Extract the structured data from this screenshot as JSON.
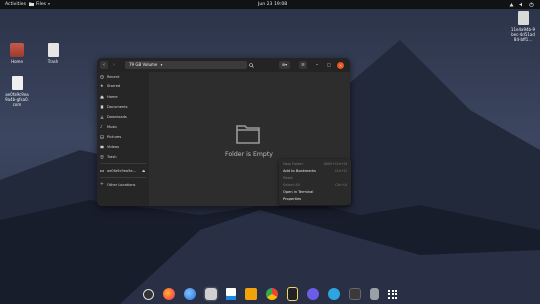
{
  "topbar": {
    "activities": "Activities",
    "app_name": "Files",
    "clock": "Jun 23  19:08"
  },
  "desktop": {
    "icons": [
      {
        "label": "Home",
        "icon": "home-folder-icon"
      },
      {
        "label": "Trash",
        "icon": "trash-icon"
      },
      {
        "label": "ae0fa9c9ea9a4b-gfsa0.com",
        "icon": "text-file-icon"
      },
      {
        "label": "11e4a94b-9bec-4d51ad84-bff1...",
        "icon": "drive-icon"
      }
    ]
  },
  "window": {
    "path_label": "79 GB Volume",
    "empty_text": "Folder is Empty",
    "sidebar": [
      {
        "label": "Recent",
        "icon": "clock-icon"
      },
      {
        "label": "Starred",
        "icon": "star-icon"
      },
      {
        "label": "Home",
        "icon": "home-icon"
      },
      {
        "label": "Documents",
        "icon": "document-icon"
      },
      {
        "label": "Downloads",
        "icon": "download-icon"
      },
      {
        "label": "Music",
        "icon": "music-icon"
      },
      {
        "label": "Pictures",
        "icon": "picture-icon"
      },
      {
        "label": "Videos",
        "icon": "video-icon"
      },
      {
        "label": "Trash",
        "icon": "trash-icon"
      },
      {
        "label": "ae0fa9c9ea9a...",
        "icon": "drive-icon"
      },
      {
        "label": "Other Locations",
        "icon": "plus-icon"
      }
    ]
  },
  "context_menu": [
    {
      "label": "New Folder",
      "shortcut": "Shift+Ctrl+N",
      "enabled": false
    },
    {
      "label": "Add to Bookmarks",
      "shortcut": "Ctrl+D",
      "enabled": true
    },
    {
      "label": "Paste",
      "shortcut": "",
      "enabled": false
    },
    {
      "label": "Select All",
      "shortcut": "Ctrl+A",
      "enabled": false
    },
    {
      "label": "Open in Terminal",
      "shortcut": "",
      "enabled": true
    },
    {
      "label": "Properties",
      "shortcut": "",
      "enabled": true
    }
  ],
  "dock": [
    {
      "name": "dock-app-ubuntu",
      "color": "#e8e8e8"
    },
    {
      "name": "dock-app-firefox",
      "color": "#ff7139"
    },
    {
      "name": "dock-app-thunderbird",
      "color": "#2a6fd6"
    },
    {
      "name": "dock-app-files",
      "color": "#cfcfcf"
    },
    {
      "name": "dock-app-libreoffice",
      "color": "#1d88e5"
    },
    {
      "name": "dock-app-software",
      "color": "#f0a30a"
    },
    {
      "name": "dock-app-chrome",
      "color": "#34a853"
    },
    {
      "name": "dock-app-notes",
      "color": "#f6d365"
    },
    {
      "name": "dock-app-mail",
      "color": "#6c5ce7"
    },
    {
      "name": "dock-app-telegram",
      "color": "#2ca5e0"
    },
    {
      "name": "dock-app-terminal",
      "color": "#3a3a3a"
    },
    {
      "name": "dock-app-trash",
      "color": "#9aa0a6"
    },
    {
      "name": "dock-app-grid",
      "color": "#ffffff"
    }
  ],
  "colors": {
    "accent_close": "#e95420"
  }
}
